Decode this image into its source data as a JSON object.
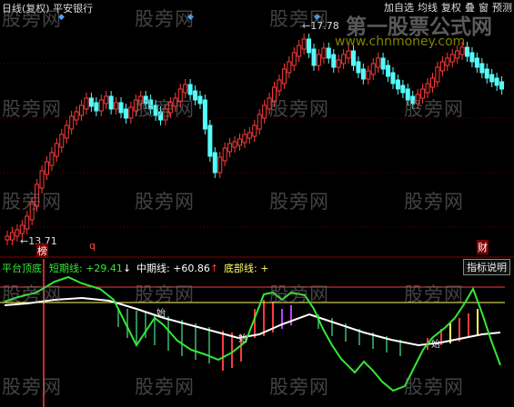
{
  "header": {
    "title": "日线(复权)   平安银行",
    "toolbar": [
      "加自选",
      "均线",
      "复权",
      "叠",
      "窗",
      "预测"
    ]
  },
  "main_chart": {
    "high_label": "17.78",
    "low_label": "13.71",
    "marker_q": "q",
    "marker_bang": "榜",
    "marker_cai": "财"
  },
  "watermarks": {
    "text": "股旁网",
    "logo": "第一股票公式网",
    "url": "www.chnmoney.com"
  },
  "indicator": {
    "name": "平台顶底",
    "short_label": "短期线:",
    "short_value": "+29.41",
    "short_arrow": "↓",
    "mid_label": "中期线:",
    "mid_value": "+60.86",
    "mid_arrow": "↑",
    "bottom_label": "底部线:",
    "bottom_value": "+",
    "help_button": "指标说明",
    "tags": [
      "始",
      "始",
      "始"
    ]
  },
  "colors": {
    "up": "#ff3a3a",
    "down": "#54fcfc",
    "grid": "#7a0000",
    "short_line": "#35e835",
    "mid_line": "#ffffff",
    "bottom_line": "#ffff66"
  }
}
